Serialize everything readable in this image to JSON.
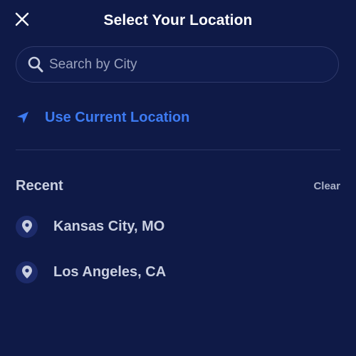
{
  "header": {
    "title": "Select Your Location",
    "close_icon": "close-icon"
  },
  "search": {
    "placeholder": "Search by City",
    "value": "",
    "icon": "search-icon"
  },
  "current_location": {
    "label": "Use Current Location",
    "icon": "navigation-arrow-icon"
  },
  "recent": {
    "heading": "Recent",
    "clear_label": "Clear",
    "items": [
      {
        "label": "Kansas City, MO",
        "icon": "location-pin-icon"
      },
      {
        "label": "Los Angeles, CA",
        "icon": "location-pin-icon"
      }
    ]
  },
  "colors": {
    "background": "#0f1a47",
    "accent": "#3d7bf2",
    "text": "#c9cfe0",
    "muted": "#9aa2bd",
    "badge": "#1d2b6a"
  }
}
